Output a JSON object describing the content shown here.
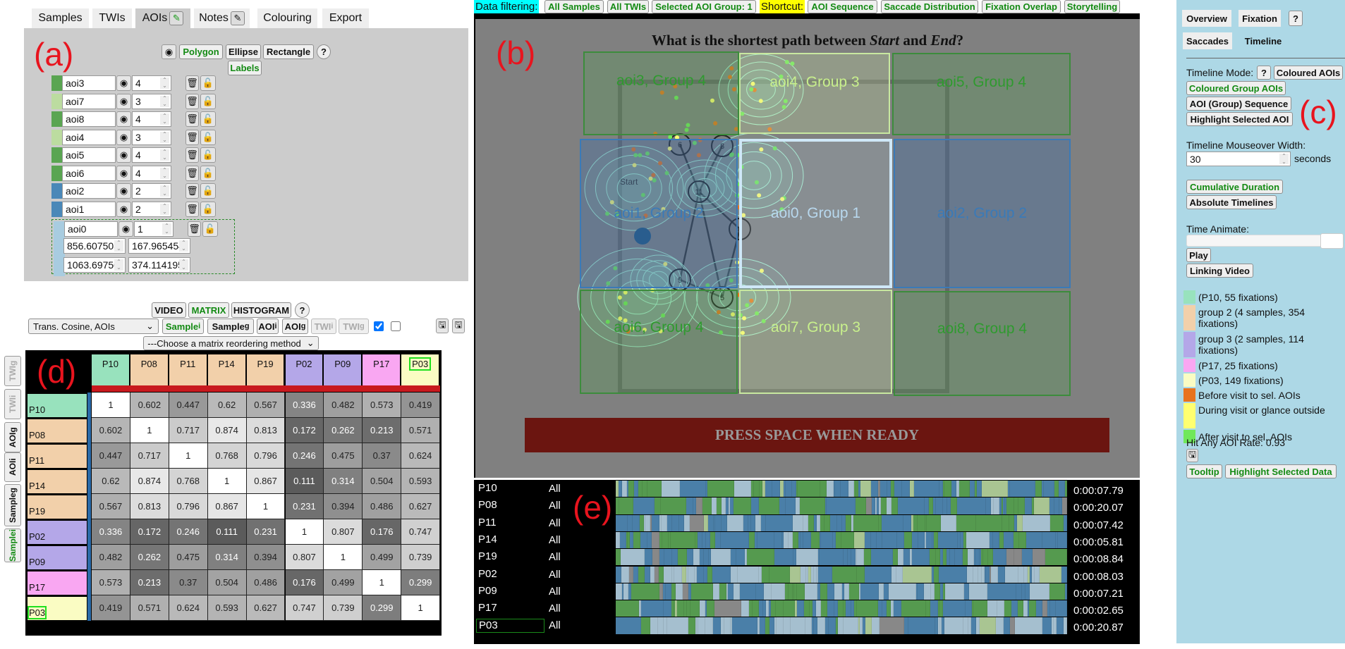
{
  "tabs": [
    {
      "label": "Samples"
    },
    {
      "label": "TWIs"
    },
    {
      "label": "AOIs",
      "edit": true
    },
    {
      "label": "Notes",
      "edit": true
    },
    {
      "label": "Colouring"
    },
    {
      "label": "Export"
    }
  ],
  "panel_labels": {
    "a": "(a)",
    "b": "(b)",
    "c": "(c)",
    "d": "(d)",
    "e": "(e)"
  },
  "aoi_panel": {
    "toolbar": {
      "eye_icon": "eye-icon",
      "polygon": "Polygon",
      "ellipse": "Ellipse",
      "rectangle": "Rectangle",
      "help": "?",
      "labels": "Labels"
    },
    "aois": [
      {
        "name": "aoi3",
        "group": "4",
        "color": "#5aa552"
      },
      {
        "name": "aoi7",
        "group": "3",
        "color": "#bcdca0"
      },
      {
        "name": "aoi8",
        "group": "4",
        "color": "#5aa552"
      },
      {
        "name": "aoi4",
        "group": "3",
        "color": "#bcdca0"
      },
      {
        "name": "aoi5",
        "group": "4",
        "color": "#5aa552"
      },
      {
        "name": "aoi6",
        "group": "4",
        "color": "#5aa552"
      },
      {
        "name": "aoi2",
        "group": "2",
        "color": "#4a88b8"
      },
      {
        "name": "aoi1",
        "group": "2",
        "color": "#4a88b8"
      },
      {
        "name": "aoi0",
        "group": "1",
        "color": "#a8cce0"
      }
    ],
    "selected_coords": [
      "856.607505",
      "167.965454",
      "1063.69750",
      "374.114195"
    ]
  },
  "top_bar": {
    "filter_label": "Data filtering:",
    "all_samples": "All Samples",
    "all_twis": "All TWIs",
    "selected_group": "Selected AOI Group: 1",
    "shortcut_label": "Shortcut:",
    "aoi_sequence": "AOI Sequence",
    "saccade_distribution": "Saccade Distribution",
    "fixation_overlap": "Fixation Overlap",
    "storytelling": "Storytelling"
  },
  "stimulus": {
    "question_pre": "What is the shortest path between ",
    "start_word": "Start",
    "mid": " and ",
    "end_word": "End",
    "qmark": "?",
    "aoi_labels": {
      "aoi3": "aoi3, Group 4",
      "aoi4": "aoi4, Group 3",
      "aoi5": "aoi5, Group 4",
      "aoi1": "aoi1, Group 2",
      "aoi0": "aoi0, Group 1",
      "aoi2": "aoi2, Group 2",
      "aoi6": "aoi6, Group 4",
      "aoi7": "aoi7, Group 3",
      "aoi8": "aoi8, Group 4"
    },
    "nodes": [
      "6",
      "8",
      "11",
      "4",
      "9",
      "5"
    ],
    "start_label": "Start",
    "press_space": "PRESS SPACE WHEN READY"
  },
  "matrix_panel": {
    "view_buttons": {
      "video": "VIDEO",
      "matrix": "MATRIX",
      "histogram": "HISTOGRAM",
      "help": "?"
    },
    "metric_select": "Trans. Cosine, AOIs",
    "mode_buttons": {
      "sample_i": "Sample",
      "sample_g": "Sample",
      "aoi_i": "AOI",
      "aoi_g": "AOI",
      "twi_i": "TWI",
      "twi_g": "TWI",
      "sub_i": "i",
      "sub_g": "g"
    },
    "checkbox1_checked": true,
    "checkbox2_checked": false,
    "reorder_select": "---Choose a matrix reordering method",
    "side_tabs": [
      "TWIg",
      "TWIi",
      "AOIg",
      "AOIi",
      "Sampleg",
      "Samplei"
    ],
    "labels": [
      "P10",
      "P08",
      "P11",
      "P14",
      "P19",
      "P02",
      "P09",
      "P17",
      "P03"
    ],
    "label_colors": [
      "#98e2bd",
      "#f2d0aa",
      "#f2d0aa",
      "#f2d0aa",
      "#f2d0aa",
      "#b4a7e8",
      "#b4a7e8",
      "#f9a7f2",
      "#fafcc3"
    ],
    "values": [
      [
        1,
        0.602,
        0.447,
        0.62,
        0.567,
        0.336,
        0.482,
        0.573,
        0.419
      ],
      [
        0.602,
        1,
        0.717,
        0.874,
        0.813,
        0.172,
        0.262,
        0.213,
        0.571
      ],
      [
        0.447,
        0.717,
        1,
        0.768,
        0.796,
        0.246,
        0.475,
        0.37,
        0.624
      ],
      [
        0.62,
        0.874,
        0.768,
        1,
        0.867,
        0.111,
        0.314,
        0.504,
        0.593
      ],
      [
        0.567,
        0.813,
        0.796,
        0.867,
        1,
        0.231,
        0.394,
        0.486,
        0.627
      ],
      [
        0.336,
        0.172,
        0.246,
        0.111,
        0.231,
        1,
        0.807,
        0.176,
        0.747
      ],
      [
        0.482,
        0.262,
        0.475,
        0.314,
        0.394,
        0.807,
        1,
        0.499,
        0.739
      ],
      [
        0.573,
        0.213,
        0.37,
        0.504,
        0.486,
        0.176,
        0.499,
        1,
        0.299
      ],
      [
        0.419,
        0.571,
        0.624,
        0.593,
        0.627,
        0.747,
        0.739,
        0.299,
        1
      ]
    ],
    "highlighted": "P03"
  },
  "timeline": {
    "rows": [
      {
        "id": "P10",
        "twi": "All",
        "duration": "0:00:07.79"
      },
      {
        "id": "P08",
        "twi": "All",
        "duration": "0:00:20.07"
      },
      {
        "id": "P11",
        "twi": "All",
        "duration": "0:00:07.42"
      },
      {
        "id": "P14",
        "twi": "All",
        "duration": "0:00:05.81"
      },
      {
        "id": "P19",
        "twi": "All",
        "duration": "0:00:08.84"
      },
      {
        "id": "P02",
        "twi": "All",
        "duration": "0:00:08.03"
      },
      {
        "id": "P09",
        "twi": "All",
        "duration": "0:00:07.21"
      },
      {
        "id": "P17",
        "twi": "All",
        "duration": "0:00:02.65"
      },
      {
        "id": "P03",
        "twi": "All",
        "duration": "0:00:20.87"
      }
    ],
    "group_colors": {
      "group1": "#a5bfcf",
      "group2": "#4a7fa8",
      "group3": "#a9c592",
      "group4": "#559a4f",
      "none": "#888888"
    }
  },
  "right_panel": {
    "tabs": {
      "overview": "Overview",
      "fixation": "Fixation",
      "help": "?",
      "saccades": "Saccades",
      "timeline": "Timeline"
    },
    "timeline_mode_label": "Timeline Mode:",
    "modes": {
      "coloured_aois": "Coloured AOIs",
      "coloured_group_aois": "Coloured Group AOIs",
      "aoi_group_sequence": "AOI (Group) Sequence",
      "highlight_selected_aoi": "Highlight Selected AOI"
    },
    "mouseover_label": "Timeline Mouseover Width:",
    "mouseover_value": "30",
    "mouseover_unit": "seconds",
    "cumulative_duration": "Cumulative Duration",
    "absolute_timelines": "Absolute Timelines",
    "time_animate_label": "Time Animate:",
    "time_animate_value": 1.0,
    "play": "Play",
    "linking_video": "Linking Video",
    "legend": [
      {
        "color": "#98e2bd",
        "text": "(P10, 55 fixations)"
      },
      {
        "color": "#f2d0aa",
        "text": "group 2 (4 samples, 354 fixations)"
      },
      {
        "color": "#b4a7e8",
        "text": "group 3 (2 samples, 114 fixations)"
      },
      {
        "color": "#f9a7f2",
        "text": "(P17, 25 fixations)"
      },
      {
        "color": "#fafcc3",
        "text": "(P03, 149 fixations)"
      },
      {
        "color": "#e8731e",
        "text": "Before visit to sel. AOIs"
      },
      {
        "color": "#ffff70",
        "text": "During visit or glance outside"
      },
      {
        "color": "#70e85a",
        "text": "After visit to sel. AOIs"
      }
    ],
    "hit_rate": "Hit Any AOI Rate: 0.93",
    "tooltip": "Tooltip",
    "highlight_selected_data": "Highlight Selected Data"
  }
}
